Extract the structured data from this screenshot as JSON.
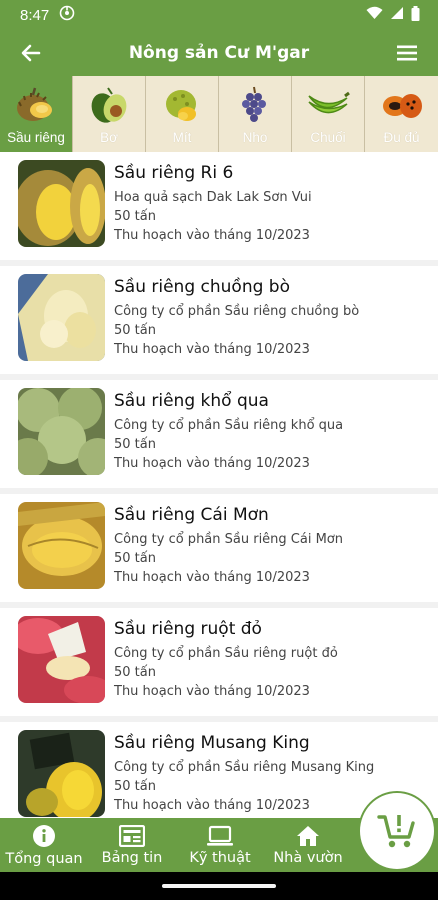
{
  "status": {
    "time": "8:47"
  },
  "header": {
    "title": "Nông sản Cư M'gar"
  },
  "tabs": [
    {
      "label": "Sầu riêng",
      "icon": "durian-icon",
      "active": true
    },
    {
      "label": "Bơ",
      "icon": "avocado-icon",
      "active": false
    },
    {
      "label": "Mít",
      "icon": "jackfruit-icon",
      "active": false
    },
    {
      "label": "Nho",
      "icon": "grape-icon",
      "active": false
    },
    {
      "label": "Chuối",
      "icon": "banana-icon",
      "active": false
    },
    {
      "label": "Đu đủ",
      "icon": "papaya-icon",
      "active": false
    }
  ],
  "products": [
    {
      "name": "Sầu riêng Ri 6",
      "company": " Hoa quả sạch Dak Lak Sơn Vui",
      "quantity": "50 tấn",
      "harvest": "Thu hoạch vào tháng 10/2023"
    },
    {
      "name": "Sầu riêng chuồng bò",
      "company": "Công ty cổ phần Sầu riêng chuồng bò",
      "quantity": "50 tấn",
      "harvest": "Thu hoạch vào tháng 10/2023"
    },
    {
      "name": "Sầu riêng khổ qua",
      "company": "Công ty cổ phần Sầu riêng khổ qua",
      "quantity": "50 tấn",
      "harvest": "Thu hoạch vào tháng 10/2023"
    },
    {
      "name": "Sầu riêng Cái Mơn",
      "company": "Công ty cổ phần Sầu riêng Cái Mơn",
      "quantity": "50 tấn",
      "harvest": "Thu hoạch vào tháng 10/2023"
    },
    {
      "name": "Sầu riêng ruột đỏ",
      "company": "Công ty cổ phần Sầu riêng ruột đỏ",
      "quantity": "50 tấn",
      "harvest": "Thu hoạch vào tháng 10/2023"
    },
    {
      "name": "Sầu riêng Musang King",
      "company": "Công ty cổ phần Sầu riêng Musang King",
      "quantity": "50 tấn",
      "harvest": "Thu hoạch vào tháng 10/2023"
    }
  ],
  "bottom_nav": [
    {
      "label": "Tổng quan",
      "icon": "info-icon"
    },
    {
      "label": "Bảng tin",
      "icon": "newspaper-icon"
    },
    {
      "label": "Kỹ thuật",
      "icon": "laptop-icon"
    },
    {
      "label": "Nhà vườn",
      "icon": "home-icon"
    }
  ],
  "cart": {
    "icon": "cart-alert-icon"
  },
  "colors": {
    "primary": "#6a9e44",
    "tab_bg": "#f0e8d2"
  }
}
